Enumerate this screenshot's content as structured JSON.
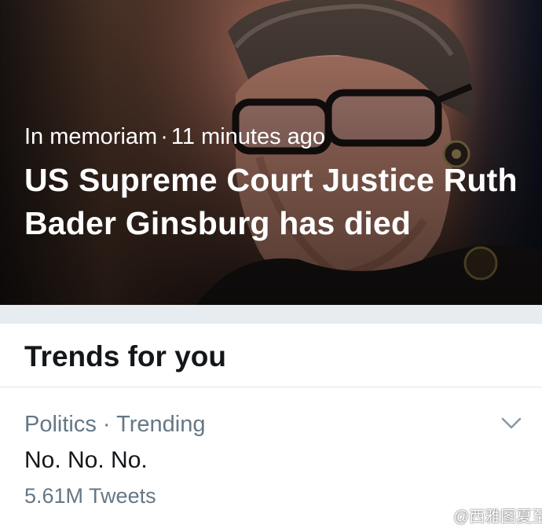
{
  "hero": {
    "category": "In memoriam",
    "separator": "·",
    "time": "11 minutes ago",
    "headline": "US Supreme Court Justice Ruth Bader Ginsburg has died"
  },
  "trends": {
    "title": "Trends for you",
    "items": [
      {
        "context": "Politics · Trending",
        "name": "No. No. No.",
        "count": "5.61M Tweets"
      }
    ]
  },
  "watermark": {
    "text": "@西雅图夏至"
  },
  "colors": {
    "band": "#e6ecf0",
    "secondary_text": "#657786",
    "primary_text": "#14171a",
    "divider": "#e1e8ed"
  },
  "icons": {
    "trend_menu": "chevron-down-icon",
    "watermark_logo": "weibo-logo-icon"
  }
}
